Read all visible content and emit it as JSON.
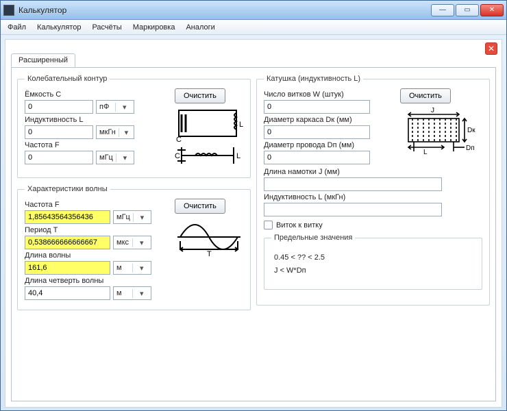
{
  "window": {
    "title": "Калькулятор"
  },
  "menu": {
    "file": "Файл",
    "calc": "Калькулятор",
    "calcs": "Расчёты",
    "marking": "Маркировка",
    "analogs": "Аналоги"
  },
  "tab": {
    "advanced": "Расширенный"
  },
  "lc": {
    "legend": "Колебательный контур",
    "cap_label": "Ёмкость C",
    "cap_value": "0",
    "cap_unit": "пФ",
    "ind_label": "Индуктивность L",
    "ind_value": "0",
    "ind_unit": "мкГн",
    "freq_label": "Частота F",
    "freq_value": "0",
    "freq_unit": "мГц",
    "clear": "Очистить"
  },
  "wave": {
    "legend": "Характеристики волны",
    "freq_label": "Частота F",
    "freq_value": "1,85643564356436",
    "freq_unit": "мГц",
    "period_label": "Период T",
    "period_value": "0,538666666666667",
    "period_unit": "мкс",
    "len_label": "Длина волны",
    "len_value": "161,6",
    "len_unit": "м",
    "qlen_label": "Длина четверть волны",
    "qlen_value": "40,4",
    "qlen_unit": "м",
    "clear": "Очистить"
  },
  "coil": {
    "legend": "Катушка (индуктивность L)",
    "turns_label": "Число витков W (штук)",
    "turns_value": "0",
    "dk_label": "Диаметр каркаса Dк (мм)",
    "dk_value": "0",
    "dp_label": "Диаметр провода Dп (мм)",
    "dp_value": "0",
    "j_label": "Длина намотки J (мм)",
    "j_value": "",
    "l_label": "Индуктивность L (мкГн)",
    "l_value": "",
    "clear": "Очистить",
    "turn_to_turn": "Виток к витку",
    "limits_legend": "Предельные значения",
    "limit1": "0.45 < ?? < 2.5",
    "limit2": "J < W*Dп",
    "diag_j": "J",
    "diag_dk": "Dк",
    "diag_l": "L",
    "diag_dp": "Dп"
  }
}
